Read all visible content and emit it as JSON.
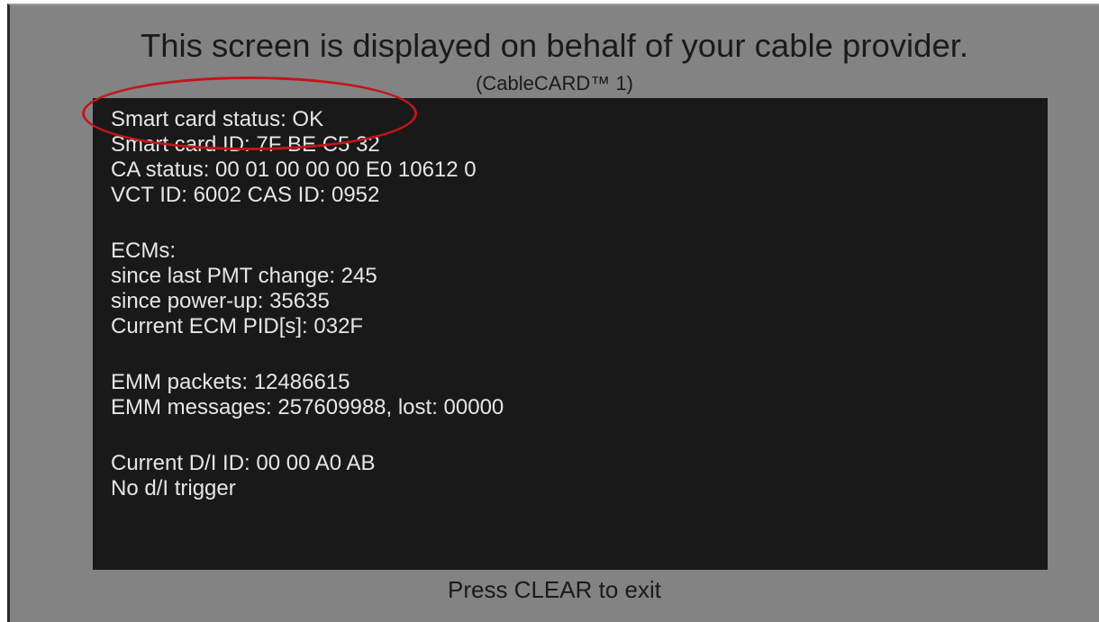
{
  "header": {
    "title": "This screen is displayed on behalf of your cable provider.",
    "subtitle": "(CableCARD™ 1)"
  },
  "card_info": {
    "lines": [
      "Smart card status: OK",
      "Smart card ID: 7F BE C5 32",
      "CA status: 00 01 00 00 00 E0 10612 0",
      "VCT ID: 6002 CAS ID: 0952",
      "ECMs:",
      "since last PMT change: 245",
      "since power-up: 35635",
      "Current ECM PID[s]: 032F",
      "EMM packets: 12486615",
      "EMM messages: 257609988, lost: 00000",
      "Current D/I ID: 00 00 A0 AB",
      "No d/I trigger"
    ]
  },
  "footer": {
    "hint": "Press CLEAR to exit"
  },
  "colors": {
    "screen_background": "#838383",
    "panel_background": "#191919",
    "panel_text": "#e6e6e6",
    "highlight_ring": "#c0161b"
  }
}
